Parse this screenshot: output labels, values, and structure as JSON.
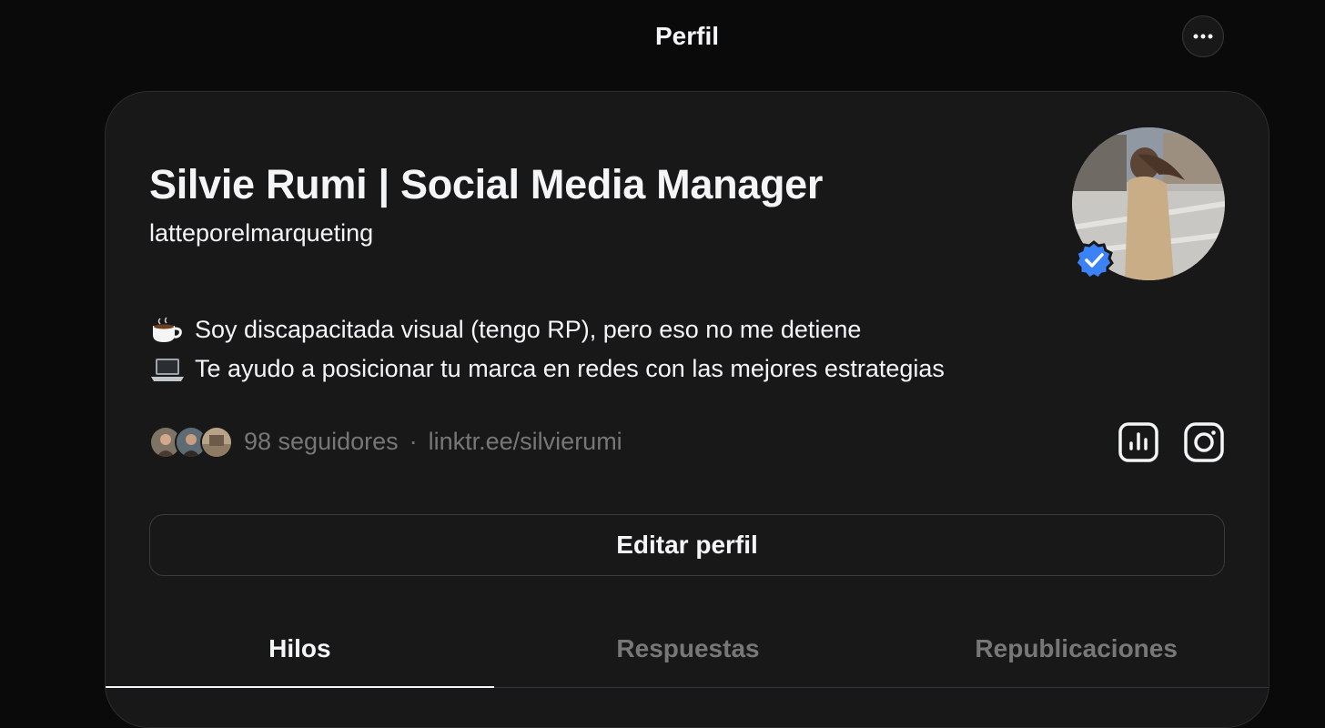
{
  "header": {
    "title": "Perfil",
    "more_icon": "more-horizontal-icon"
  },
  "profile": {
    "display_name": "Silvie Rumi | Social Media Manager",
    "username": "latteporelmarqueting",
    "verified": true,
    "verified_color": "#3b82f6",
    "bio": [
      {
        "emoji": "coffee-icon",
        "text": "Soy discapacitada visual (tengo RP), pero eso no me detiene"
      },
      {
        "emoji": "laptop-icon",
        "text": "Te ayudo a posicionar tu marca en redes con las mejores estrategias"
      }
    ],
    "followers_text": "98 seguidores",
    "separator": "·",
    "link": "linktr.ee/silvierumi"
  },
  "actions": {
    "insights_icon": "bar-chart-icon",
    "instagram_icon": "instagram-icon",
    "edit_label": "Editar perfil"
  },
  "tabs": [
    {
      "label": "Hilos",
      "active": true
    },
    {
      "label": "Respuestas",
      "active": false
    },
    {
      "label": "Republicaciones",
      "active": false
    }
  ],
  "colors": {
    "background": "#0a0a0a",
    "card": "#181818",
    "text": "#f3f5f7",
    "muted": "#777777",
    "border": "#333638"
  }
}
